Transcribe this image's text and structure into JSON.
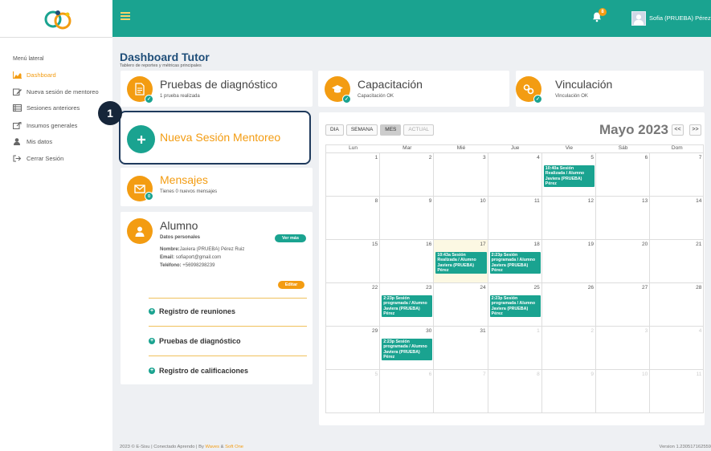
{
  "sidebar": {
    "menu_title": "Menú lateral",
    "items": [
      {
        "label": "Dashboard",
        "icon": "chart-area-icon",
        "active": true
      },
      {
        "label": "Nueva sesión de mentoreo",
        "icon": "edit-icon"
      },
      {
        "label": "Sesiones anteriores",
        "icon": "list-icon"
      },
      {
        "label": "Insumos generales",
        "icon": "external-link-icon"
      },
      {
        "label": "Mis datos",
        "icon": "user-icon"
      },
      {
        "label": "Cerrar Sesión",
        "icon": "sign-out-icon"
      }
    ]
  },
  "topbar": {
    "notification_count": "8",
    "user_name": "Sofia (PRUEBA) Pérez -"
  },
  "header": {
    "title": "Dashboard Tutor",
    "subtitle": "Tablero de reportes y métricas principales"
  },
  "cards": {
    "pruebas": {
      "title": "Pruebas de diagnóstico",
      "subtitle": "1 prueba realizada"
    },
    "capacitacion": {
      "title": "Capacitación",
      "subtitle": "Capacitación OK"
    },
    "vinculacion": {
      "title": "Vinculación",
      "subtitle": "Vinculación OK"
    },
    "nueva_sesion": {
      "title": "Nueva Sesión Mentoreo"
    },
    "mensajes": {
      "title": "Mensajes",
      "subtitle": "Tienes 0 nuevos mensajes",
      "badge": "0"
    }
  },
  "callout": {
    "step": "1"
  },
  "alumno": {
    "title": "Alumno",
    "section": "Datos personales",
    "ver_mas": "Ver más",
    "editar": "Editar",
    "nombre_label": "Nombre:",
    "nombre": "Javiera (PRUEBA) Pérez Ruiz",
    "email_label": "Email:",
    "email": "sofiaport@gmail.com",
    "telefono_label": "Teléfono:",
    "telefono": "+56998298239",
    "accordion": [
      "Registro de reuniones",
      "Pruebas de diagnóstico",
      "Registro de calificaciones"
    ]
  },
  "calendar": {
    "buttons": {
      "dia": "DIA",
      "semana": "SEMANA",
      "mes": "MES",
      "actual": "ACTUAL"
    },
    "month": "Mayo 2023",
    "prev": "<<",
    "next": ">>",
    "days": [
      "Lun",
      "Mar",
      "Mié",
      "Jue",
      "Vie",
      "Sáb",
      "Dom"
    ],
    "weeks": [
      [
        "1",
        "2",
        "3",
        "4",
        "5",
        "6",
        "7"
      ],
      [
        "8",
        "9",
        "10",
        "11",
        "12",
        "13",
        "14"
      ],
      [
        "15",
        "16",
        "17",
        "18",
        "19",
        "20",
        "21"
      ],
      [
        "22",
        "23",
        "24",
        "25",
        "26",
        "27",
        "28"
      ],
      [
        "29",
        "30",
        "31",
        "1",
        "2",
        "3",
        "4"
      ],
      [
        "5",
        "6",
        "7",
        "8",
        "9",
        "10",
        "11"
      ]
    ],
    "events": [
      {
        "week": 0,
        "day": 4,
        "text": "10:40a Sesión\nRealizada / Alumno\nJaviera (PRUEBA)\nPérez"
      },
      {
        "week": 2,
        "day": 2,
        "text": "10:43a Sesión\nRealizada / Alumno\nJaviera (PRUEBA)\nPérez"
      },
      {
        "week": 2,
        "day": 3,
        "text": "2:23p Sesión\nprogramada / Alumno\nJaviera (PRUEBA)\nPérez"
      },
      {
        "week": 3,
        "day": 1,
        "text": "2:23p Sesión\nprogramada / Alumno\nJaviera (PRUEBA)\nPérez"
      },
      {
        "week": 3,
        "day": 3,
        "text": "2:23p Sesión\nprogramada / Alumno\nJaviera (PRUEBA)\nPérez"
      },
      {
        "week": 4,
        "day": 1,
        "text": "2:23p Sesión\nprogramada / Alumno\nJaviera (PRUEBA)\nPérez"
      }
    ]
  },
  "footer": {
    "left": "2023 © E-Sisu | Conectado Aprendo | By ",
    "link1": "Waves",
    "amp": " & ",
    "link2": "Soft One",
    "version": "Version 1.230517162559"
  },
  "colors": {
    "teal": "#1aa390",
    "orange": "#f39c12",
    "navy": "#1f4e79"
  }
}
